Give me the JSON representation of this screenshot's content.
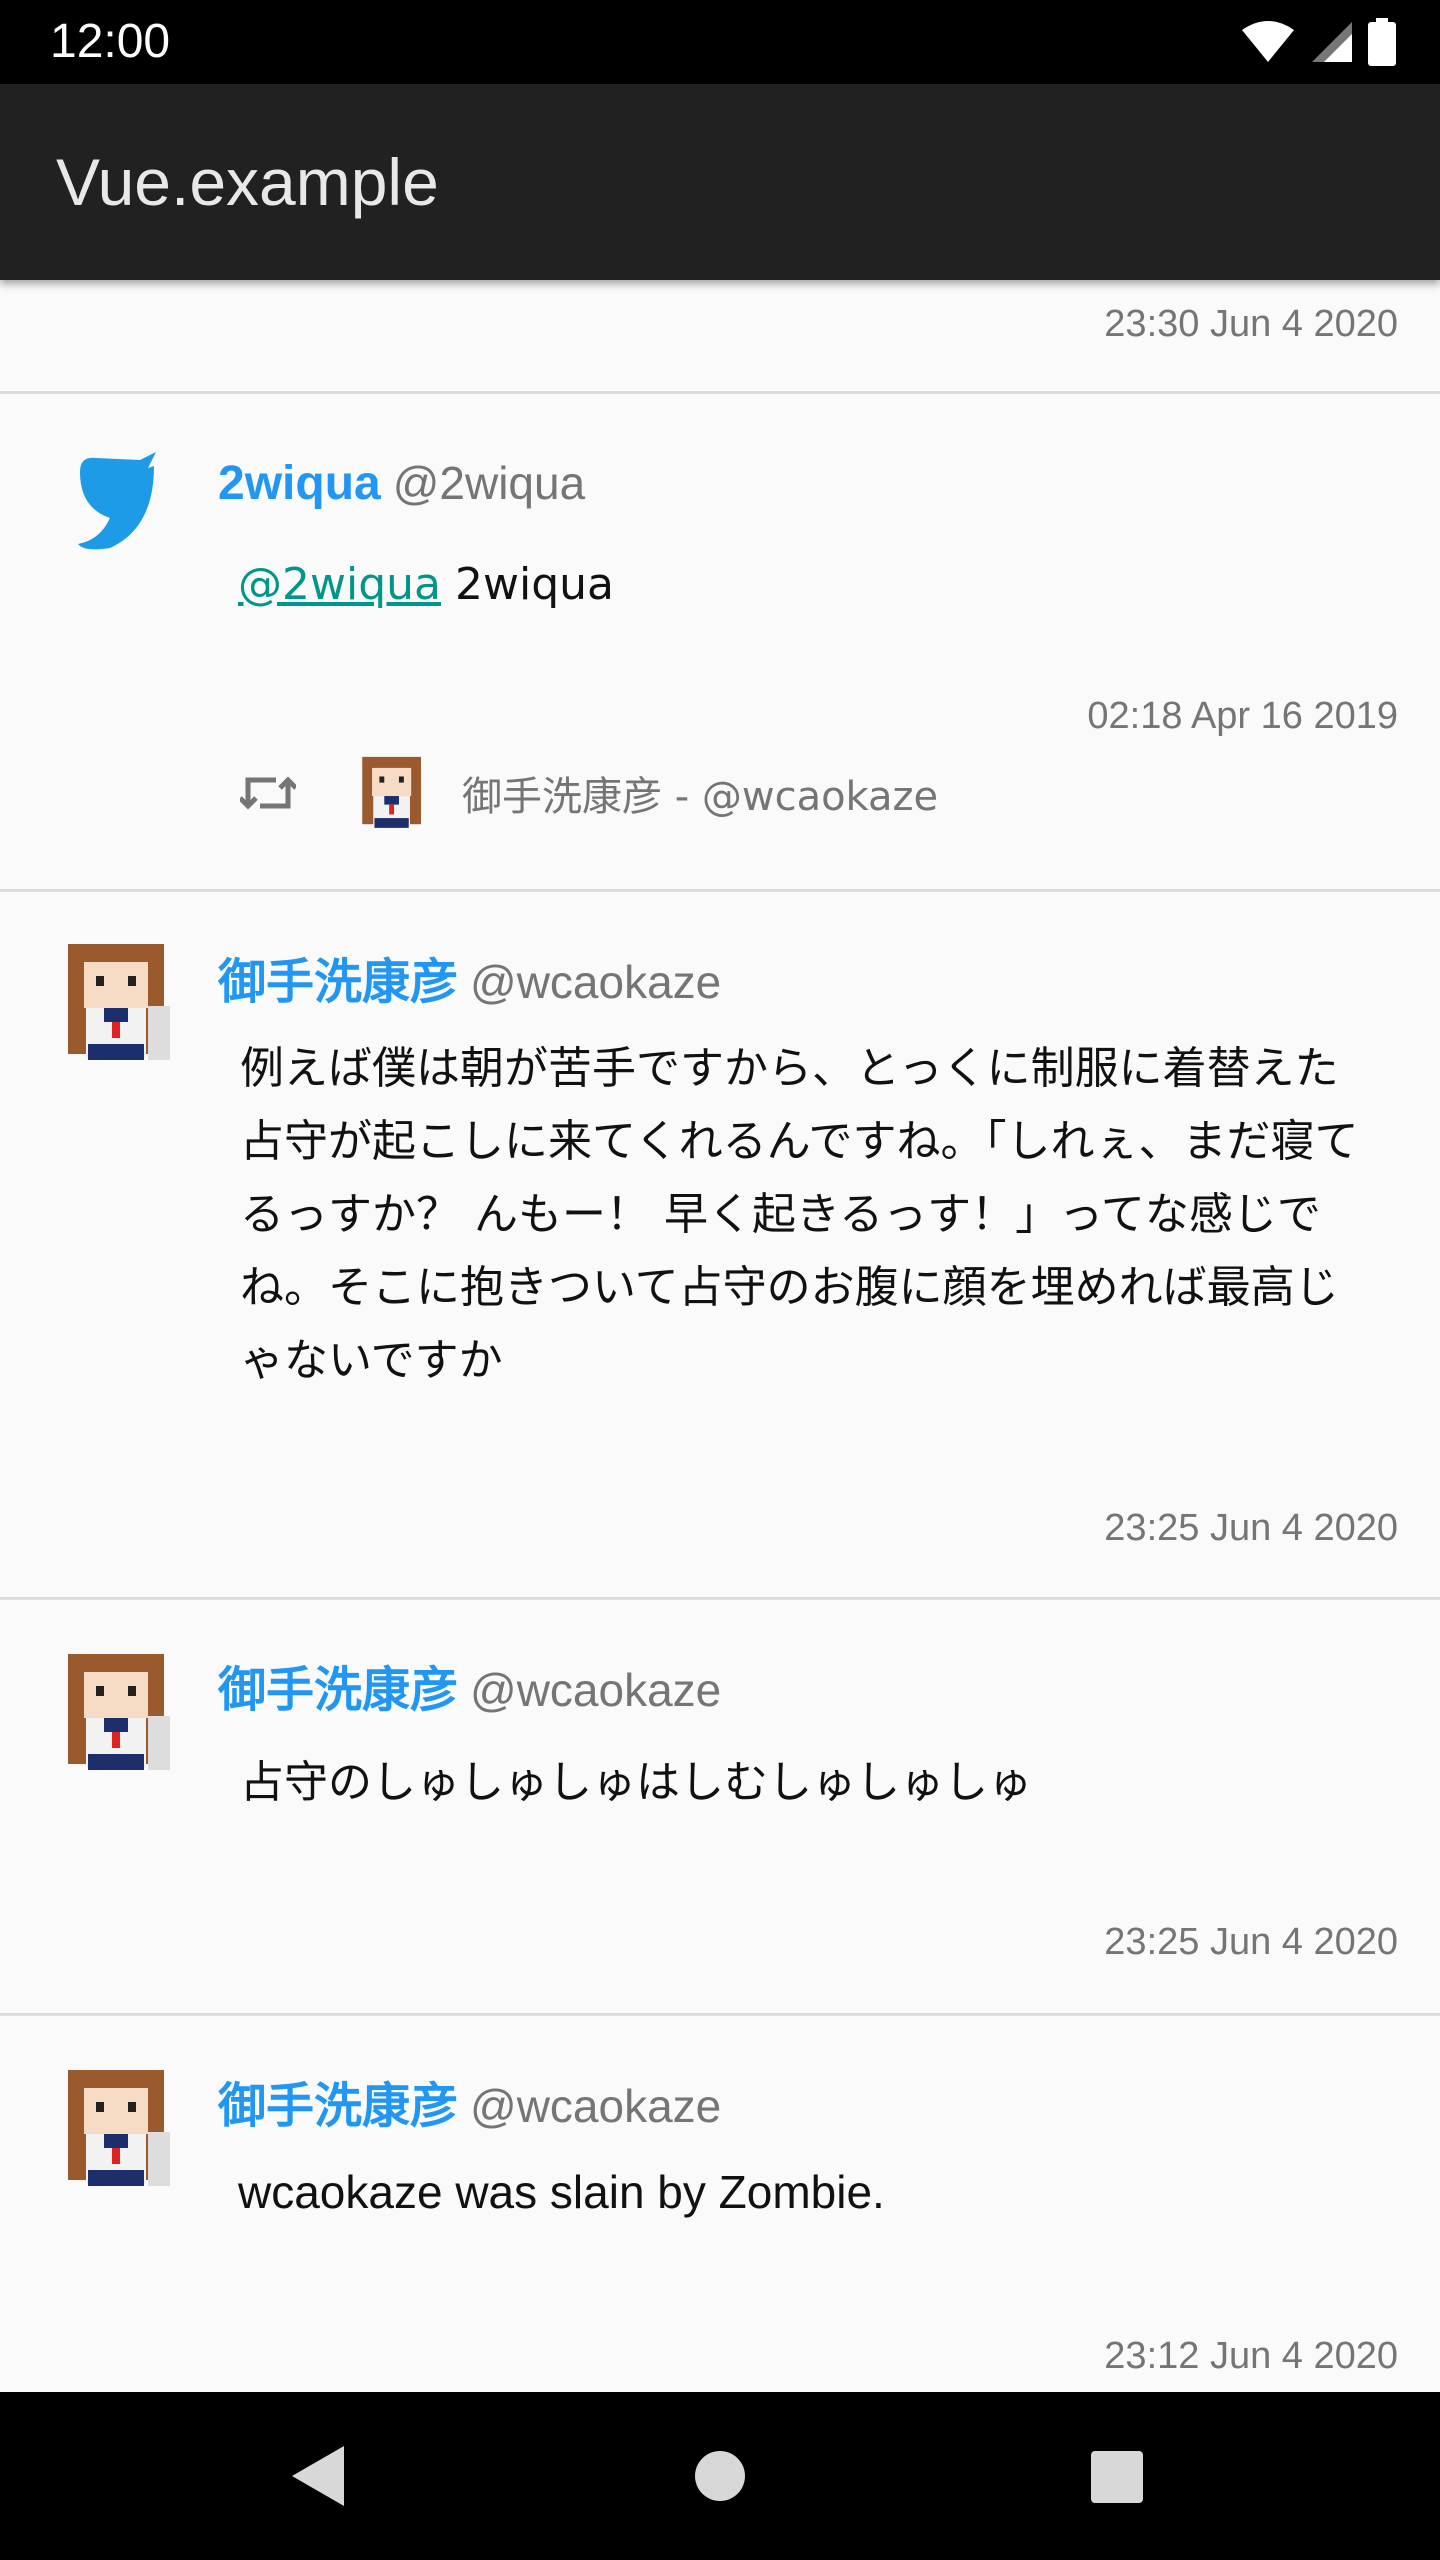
{
  "status_bar": {
    "time": "12:00"
  },
  "app_bar": {
    "title": "Vue.example"
  },
  "tweets": [
    {
      "timestamp": "23:30 Jun 4 2020"
    },
    {
      "name": "2wiqua",
      "handle": "@2wiqua",
      "mention": "@2wiqua",
      "text": "2wiqua",
      "timestamp": "02:18 Apr 16 2019",
      "retweeted_by": "御手洗康彦 - @wcaokaze"
    },
    {
      "name": "御手洗康彦",
      "handle": "@wcaokaze",
      "text": "例えば僕は朝が苦手ですから、とっくに制服に着替えた占守が起こしに来てくれるんですね。「しれぇ、まだ寝てるっすか？ んもー！ 早く起きるっす！」ってな感じでね。そこに抱きついて占守のお腹に顔を埋めれば最高じゃないですか",
      "timestamp": "23:25 Jun 4 2020"
    },
    {
      "name": "御手洗康彦",
      "handle": "@wcaokaze",
      "text": "占守のしゅしゅしゅはしむしゅしゅしゅ",
      "timestamp": "23:25 Jun 4 2020"
    },
    {
      "name": "御手洗康彦",
      "handle": "@wcaokaze",
      "text": "wcaokaze was slain by Zombie.",
      "timestamp": "23:12 Jun 4 2020"
    }
  ],
  "icons": {
    "wifi": "wifi-icon",
    "cell": "cell-signal-icon",
    "battery": "battery-icon",
    "retweet": "retweet-icon",
    "back": "back-icon",
    "home": "home-icon",
    "recents": "recents-icon"
  },
  "colors": {
    "accent": "#2196f3",
    "mention": "#009688",
    "app_bar": "#212121"
  }
}
